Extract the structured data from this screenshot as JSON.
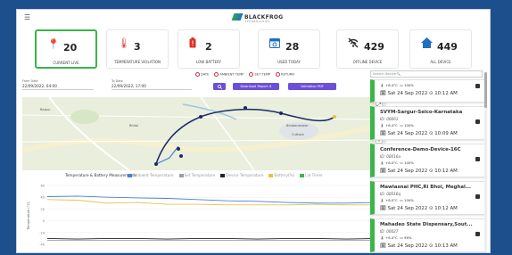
{
  "header": {
    "menu_icon": "hamburger-icon",
    "logo_text": "BLACKFROG",
    "logo_sub": "TECHNOLOGIES"
  },
  "cards": [
    {
      "value": "20",
      "label": "CURRENT LIVE",
      "icon": "location-pin-icon",
      "color": "#3bb54a"
    },
    {
      "value": "3",
      "label": "TEMPERATURE VIOLATION",
      "icon": "thermometer-icon",
      "color": "#d93025"
    },
    {
      "value": "2",
      "label": "LOW BATTERY",
      "icon": "battery-alert-icon",
      "color": "#d93025"
    },
    {
      "value": "28",
      "label": "USED TODAY",
      "icon": "calendar-icon",
      "color": "#1f6fc2"
    },
    {
      "value": "429",
      "label": "OFFLINE DEVICE",
      "icon": "wifi-off-icon",
      "color": "#444444"
    },
    {
      "value": "449",
      "label": "ALL DEVICE",
      "icon": "home-icon",
      "color": "#1f6fc2"
    }
  ],
  "map_legend": {
    "items": [
      "DATE",
      "AMBIENT TEMP",
      "SET TEMP",
      "RETURN"
    ]
  },
  "filters": {
    "from_label": "From Date",
    "from_value": "22/09/2022, 04:00",
    "to_label": "To Date",
    "to_value": "22/09/2022, 17:00",
    "download_label": "Download Report",
    "validation_label": "Validation PDF"
  },
  "map": {
    "labels": [
      "Raipur",
      "Bhubaneswar",
      "Cuttack",
      "Bhilai"
    ]
  },
  "chart": {
    "title": "Temperature & Battery Measurements",
    "legend": [
      "Ambient Temperature",
      "Set Temperature",
      "Device Temperature",
      "Battery(%)",
      "Lid Timer"
    ],
    "legend_colors": [
      "#4a7fd4",
      "#9e9e9e",
      "#222222",
      "#e5c14a",
      "#3bb54a"
    ]
  },
  "chart_data": {
    "type": "line",
    "title": "Temperature & Battery Measurements",
    "xlabel": "",
    "ylabel": "Temperature (°C)",
    "ylim": [
      -40,
      60
    ],
    "series": [
      {
        "name": "Ambient Temperature",
        "values": [
          41,
          42,
          40,
          39,
          38,
          36,
          34,
          33,
          31,
          30,
          30,
          31
        ]
      },
      {
        "name": "Battery(%)",
        "values": [
          36,
          35,
          30,
          31,
          28,
          28,
          27,
          27,
          27,
          28,
          27,
          27
        ]
      },
      {
        "name": "Device Temperature",
        "values": [
          -30,
          -31,
          -30,
          -30,
          -31,
          -30,
          -30,
          -31,
          -30,
          -30,
          -31,
          -30
        ]
      },
      {
        "name": "Set Temperature",
        "values": [
          -33,
          -33,
          -33,
          -33,
          -33,
          -33,
          -33,
          -33,
          -33,
          -33,
          -33,
          -33
        ]
      }
    ]
  },
  "sidebar": {
    "search_placeholder": "Search Device",
    "devices": [
      {
        "name": "",
        "id": "",
        "temp": "+8.4°C",
        "battery": "100%",
        "timestamp": "Sat 24 Sep 2022 ⊙ 10:12 AM"
      },
      {
        "name": "SVYM-Sargur-Seico-Karnataka",
        "id": "ID: 00061",
        "temp": "+6.4°C",
        "battery": "100%",
        "timestamp": "Sat 24 Sep 2022 ⊙ 10:09 AM"
      },
      {
        "name": "Conference-Demo-Device-16C",
        "id": "ID: 00016a",
        "temp": "+8.0°C",
        "battery": "100%",
        "timestamp": "Sat 24 Sep 2022 ⊙ 10:12 AM"
      },
      {
        "name": "Mawlasnai PHC,Ri Bhoi, Meghal...",
        "id": "ID: 00016q",
        "temp": "+8.0°C",
        "battery": "100%",
        "timestamp": "Sat 24 Sep 2022 ⊙ 10:12 AM"
      },
      {
        "name": "Mahadeo State Dispensary,Sout...",
        "id": "ID: 00027",
        "temp": "+8.4°C",
        "battery": "96%",
        "timestamp": "Sat 24 Sep 2022 ⊙ 10:13 AM"
      }
    ]
  }
}
